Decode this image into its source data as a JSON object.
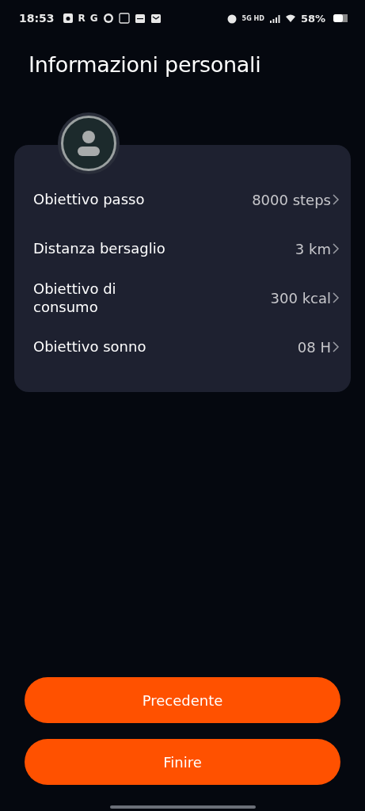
{
  "status_bar": {
    "time": "18:53",
    "notification_letters": [
      "R",
      "G"
    ],
    "network": "5G HD",
    "battery": "58%"
  },
  "title": "Informazioni personali",
  "goals": [
    {
      "label": "Obiettivo passo",
      "value": "8000 steps"
    },
    {
      "label": "Distanza bersaglio",
      "value": "3 km"
    },
    {
      "label": "Obiettivo di\nconsumo",
      "value": "300 kcal"
    },
    {
      "label": "Obiettivo sonno",
      "value": "08 H"
    }
  ],
  "buttons": [
    "Precedente",
    "Finire"
  ]
}
